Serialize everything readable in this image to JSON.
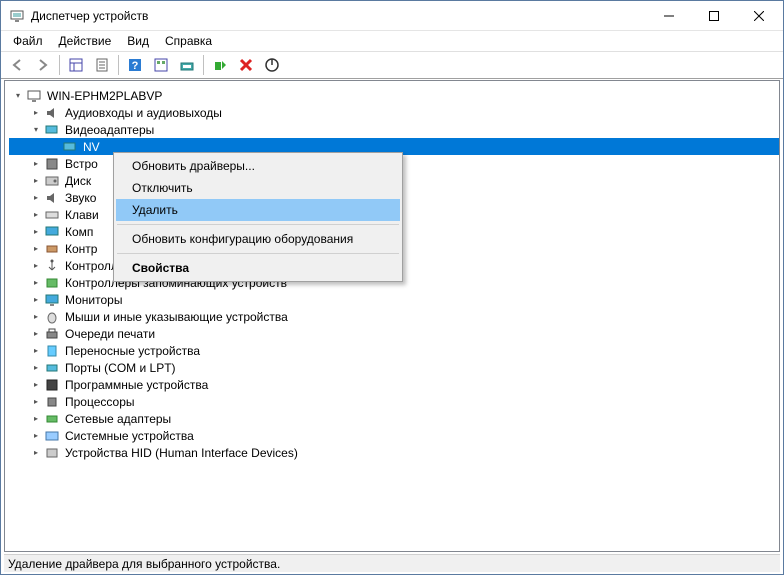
{
  "window": {
    "title": "Диспетчер устройств"
  },
  "menu": {
    "file": "Файл",
    "action": "Действие",
    "view": "Вид",
    "help": "Справка"
  },
  "tree": {
    "root": "WIN-EPHM2PLABVP",
    "audio": "Аудиовходы и аудиовыходы",
    "video": "Видеоадаптеры",
    "video_child": "NV",
    "builtin": "Встро",
    "disk": "Диск",
    "sound": "Звуко",
    "keyboard": "Клави",
    "computer": "Комп",
    "controllers": "Контр",
    "usb_ctrl": "Контроллеры USB",
    "storage_ctrl": "Контроллеры запоминающих устройств",
    "monitors": "Мониторы",
    "mice": "Мыши и иные указывающие устройства",
    "print_queues": "Очереди печати",
    "portable": "Переносные устройства",
    "ports": "Порты (COM и LPT)",
    "software": "Программные устройства",
    "processors": "Процессоры",
    "network": "Сетевые адаптеры",
    "system": "Системные устройства",
    "hid": "Устройства HID (Human Interface Devices)"
  },
  "context_menu": {
    "update": "Обновить драйверы...",
    "disable": "Отключить",
    "delete": "Удалить",
    "scan": "Обновить конфигурацию оборудования",
    "properties": "Свойства"
  },
  "status": "Удаление драйвера для выбранного устройства."
}
